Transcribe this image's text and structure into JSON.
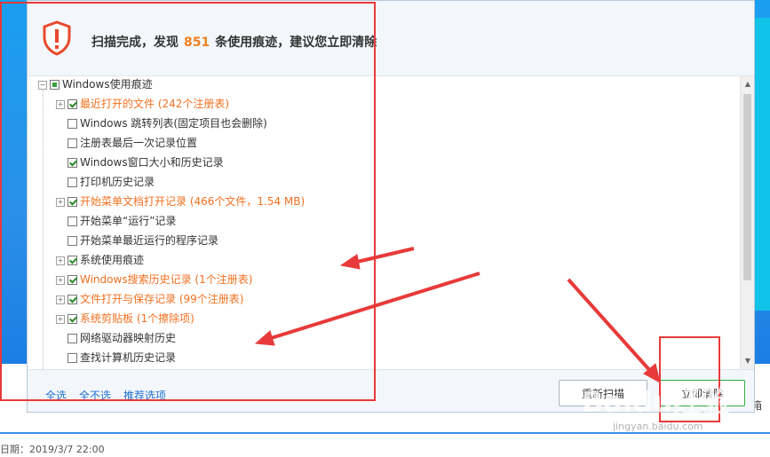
{
  "header": {
    "title_prefix": "扫描完成，发现",
    "count": "851",
    "title_suffix": "条使用痕迹，建议您立即清除"
  },
  "tree": {
    "items": [
      {
        "label": "Windows使用痕迹",
        "state": "partial",
        "expander": true,
        "level": 0,
        "highlight": false
      },
      {
        "label": "最近打开的文件 (242个注册表)",
        "state": "checked",
        "expander": true,
        "level": 1,
        "highlight": true
      },
      {
        "label": "Windows 跳转列表(固定项目也会删除)",
        "state": "unchecked",
        "expander": false,
        "level": 1,
        "highlight": false
      },
      {
        "label": "注册表最后一次记录位置",
        "state": "unchecked",
        "expander": false,
        "level": 1,
        "highlight": false
      },
      {
        "label": "Windows窗口大小和历史记录",
        "state": "checked",
        "expander": false,
        "level": 1,
        "highlight": false
      },
      {
        "label": "打印机历史记录",
        "state": "unchecked",
        "expander": false,
        "level": 1,
        "highlight": false
      },
      {
        "label": "开始菜单文档打开记录 (466个文件，1.54 MB)",
        "state": "checked",
        "expander": true,
        "level": 1,
        "highlight": true
      },
      {
        "label": "开始菜单“运行”记录",
        "state": "unchecked",
        "expander": false,
        "level": 1,
        "highlight": false
      },
      {
        "label": "开始菜单最近运行的程序记录",
        "state": "unchecked",
        "expander": false,
        "level": 1,
        "highlight": false
      },
      {
        "label": "系统使用痕迹",
        "state": "checked",
        "expander": true,
        "level": 1,
        "highlight": false
      },
      {
        "label": "Windows搜索历史记录 (1个注册表)",
        "state": "checked",
        "expander": true,
        "level": 1,
        "highlight": true
      },
      {
        "label": "文件打开与保存记录 (99个注册表)",
        "state": "checked",
        "expander": true,
        "level": 1,
        "highlight": true
      },
      {
        "label": "系统剪贴板 (1个擦除项)",
        "state": "checked",
        "expander": true,
        "level": 1,
        "highlight": true
      },
      {
        "label": "网络驱动器映射历史",
        "state": "unchecked",
        "expander": false,
        "level": 1,
        "highlight": false
      },
      {
        "label": "查找计算机历史记录",
        "state": "unchecked",
        "expander": false,
        "level": 1,
        "highlight": false
      }
    ]
  },
  "footer": {
    "select_all": "全选",
    "select_none": "全不选",
    "recommended": "推荐选项",
    "rescan": "重新扫描",
    "clean_now": "立即清除"
  },
  "background": {
    "date_text": "日期：2019/3/7 22:00",
    "right_label": "箱"
  },
  "watermark": {
    "brand": "Baidu经验",
    "url": "jingyan.baidu.com"
  },
  "colors": {
    "highlight_text": "#f07020",
    "count_text": "#f08020",
    "link": "#1e6fd0",
    "annotation": "#e83a3a",
    "check_green": "#2a8a2a",
    "clean_button_border": "#2fae3f"
  }
}
